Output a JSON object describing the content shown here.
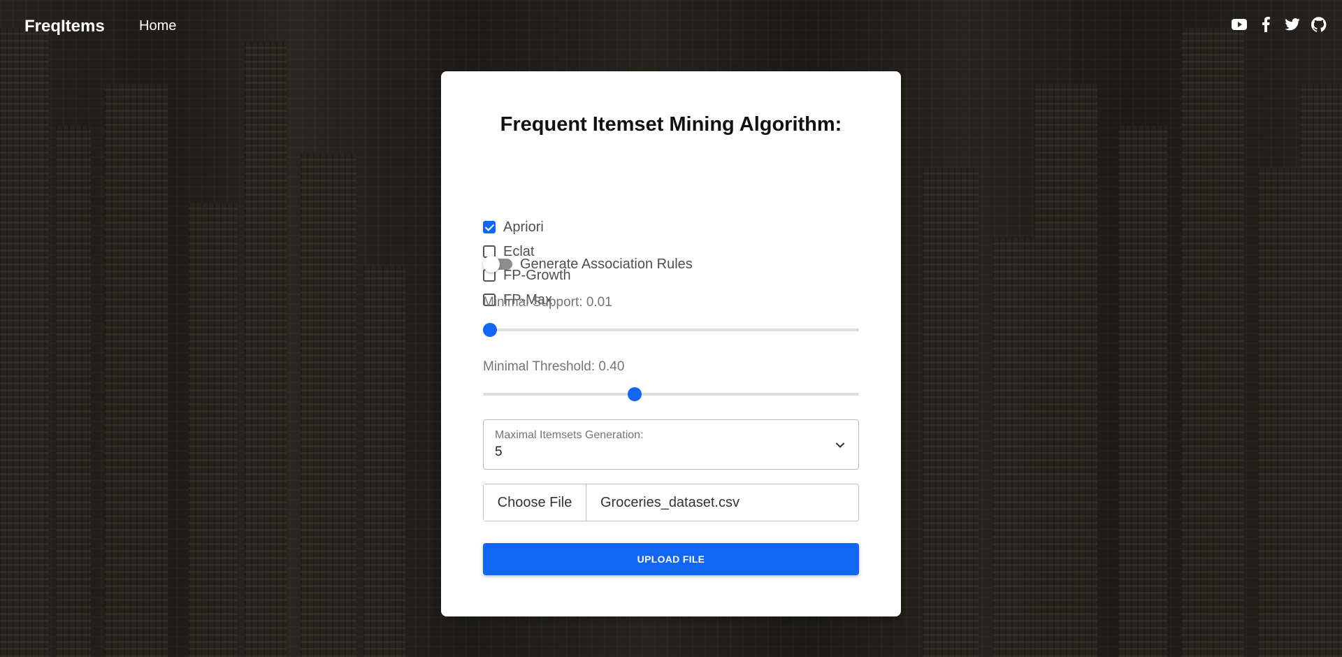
{
  "navbar": {
    "brand": "FreqItems",
    "home_label": "Home",
    "social_icons": [
      "youtube-icon",
      "facebook-icon",
      "twitter-icon",
      "github-icon"
    ]
  },
  "card": {
    "title": "Frequent Itemset Mining Algorithm:",
    "algorithms": [
      {
        "label": "Apriori",
        "checked": true
      },
      {
        "label": "Eclat",
        "checked": false
      },
      {
        "label": "FP-Growth",
        "checked": false
      },
      {
        "label": "FP-Max",
        "checked": false
      }
    ],
    "association_rules": {
      "label": "Generate Association Rules",
      "enabled": false
    },
    "min_support": {
      "label": "Minimal Support: 0.01",
      "value": 0.01,
      "fraction": 0.0
    },
    "min_threshold": {
      "label": "Minimal Threshold: 0.40",
      "value": 0.4,
      "fraction": 0.4
    },
    "max_itemsets": {
      "caption": "Maximal Itemsets Generation:",
      "value": "5"
    },
    "file_input": {
      "button_label": "Choose File",
      "file_name": "Groceries_dataset.csv"
    },
    "upload_label": "UPLOAD FILE"
  },
  "colors": {
    "accent": "#1266f1",
    "card_bg": "#ffffff"
  }
}
